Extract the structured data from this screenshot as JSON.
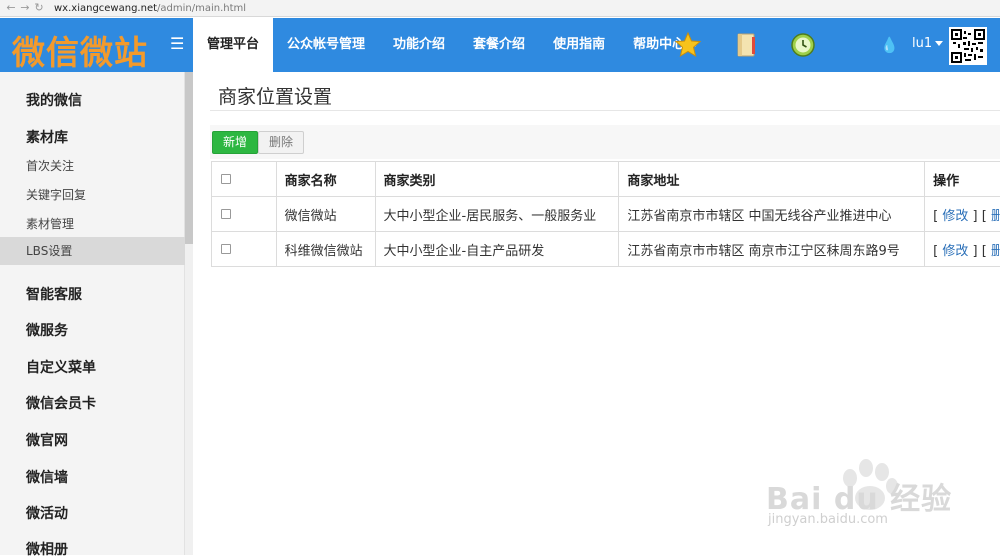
{
  "browser": {
    "url_host": "wx.xiangcewang.net",
    "url_path": "/admin/main.html"
  },
  "header": {
    "logo": "微信微站",
    "nav": [
      {
        "label": "管理平台",
        "active": true
      },
      {
        "label": "公众帐号管理"
      },
      {
        "label": "功能介绍"
      },
      {
        "label": "套餐介绍"
      },
      {
        "label": "使用指南"
      },
      {
        "label": "帮助中心"
      }
    ],
    "user": "lu1"
  },
  "sidebar": {
    "items": [
      {
        "label": "我的微信",
        "level": "main"
      },
      {
        "label": "素材库",
        "level": "main"
      },
      {
        "label": "首次关注",
        "level": "sub"
      },
      {
        "label": "关键字回复",
        "level": "sub"
      },
      {
        "label": "素材管理",
        "level": "sub"
      },
      {
        "label": "LBS设置",
        "level": "sub",
        "selected": true
      },
      {
        "label": "智能客服",
        "level": "main"
      },
      {
        "label": "微服务",
        "level": "main"
      },
      {
        "label": "自定义菜单",
        "level": "main"
      },
      {
        "label": "微信会员卡",
        "level": "main"
      },
      {
        "label": "微官网",
        "level": "main"
      },
      {
        "label": "微信墙",
        "level": "main"
      },
      {
        "label": "微活动",
        "level": "main"
      },
      {
        "label": "微相册",
        "level": "main"
      }
    ]
  },
  "main": {
    "title": "商家位置设置",
    "add_label": "新增",
    "delete_label": "删除",
    "columns": [
      "商家名称",
      "商家类别",
      "商家地址",
      "操作"
    ],
    "rows": [
      {
        "name": "微信微站",
        "category": "大中小型企业-居民服务、一般服务业",
        "address": "江苏省南京市市辖区 中国无线谷产业推进中心"
      },
      {
        "name": "科维微信微站",
        "category": "大中小型企业-自主产品研发",
        "address": "江苏省南京市市辖区 南京市江宁区秣周东路9号"
      }
    ],
    "action_edit": "修改",
    "action_delete": "删",
    "bracket_open": "[",
    "bracket_close": "]"
  },
  "watermark": {
    "text": "Bai du 经验",
    "url": "jingyan.baidu.com"
  },
  "colors": {
    "header_bg": "#2f8ae0",
    "logo": "#f39a2c",
    "add_button": "#2db741",
    "link": "#2a6fb8"
  }
}
